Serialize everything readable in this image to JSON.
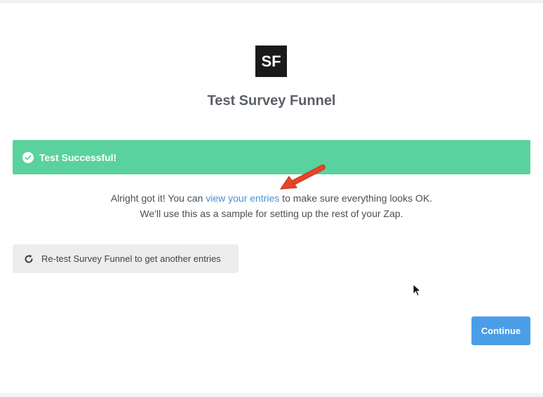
{
  "logo": {
    "text": "SF"
  },
  "header": {
    "title": "Test Survey Funnel"
  },
  "alert": {
    "text": "Test Successful!",
    "color": "#5ad29d"
  },
  "message": {
    "line1_prefix": "Alright got it! You can ",
    "link_text": "view your entries",
    "line1_suffix": " to make sure everything looks OK.",
    "line2": "We'll use this as a sample for setting up the rest of your Zap."
  },
  "retest_button": {
    "label": "Re-test Survey Funnel to get another entries",
    "icon": "refresh-icon"
  },
  "continue_button": {
    "label": "Continue",
    "color": "#4a9ee7"
  },
  "annotation": {
    "icon": "red-arrow-icon",
    "color": "#e8432d"
  }
}
